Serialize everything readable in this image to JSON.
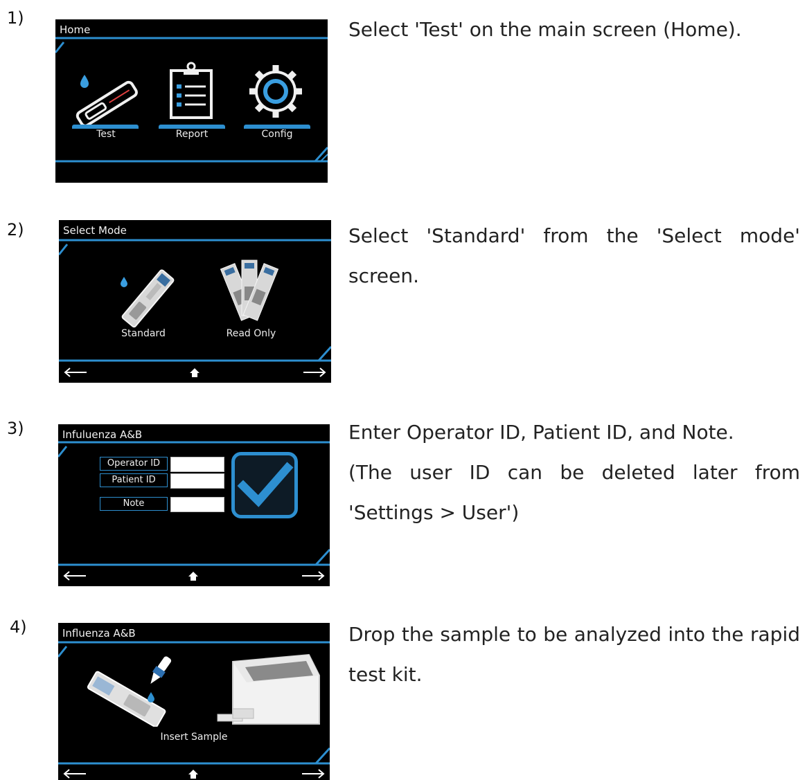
{
  "steps": [
    {
      "number": "1)",
      "description": "Select 'Test' on the main screen (Home).",
      "screen": {
        "title": "Home",
        "items": [
          {
            "label": "Test",
            "icon": "test-strip-icon"
          },
          {
            "label": "Report",
            "icon": "clipboard-report-icon"
          },
          {
            "label": "Config",
            "icon": "gear-icon"
          }
        ]
      }
    },
    {
      "number": "2)",
      "description": "Select 'Standard' from the 'Select mode' screen.",
      "screen": {
        "title": "Select Mode",
        "items": [
          {
            "label": "Standard",
            "icon": "single-test-strip-icon"
          },
          {
            "label": "Read Only",
            "icon": "multiple-test-strips-icon"
          }
        ]
      }
    },
    {
      "number": "3)",
      "description": "Enter Operator ID, Patient ID, and Note.",
      "description_2": "(The user ID can be deleted later from 'Settings > User')",
      "screen": {
        "title": "Infuluenza A&B",
        "fields": [
          {
            "label": "Operator ID",
            "value": ""
          },
          {
            "label": "Patient ID",
            "value": ""
          },
          {
            "label": "Note",
            "value": ""
          }
        ],
        "confirm_icon": "checkmark-icon"
      }
    },
    {
      "number": "4)",
      "description": "Drop the sample to be analyzed into the rapid test kit.",
      "screen": {
        "title": "Influenza A&B",
        "caption": "Insert Sample"
      }
    }
  ],
  "nav": {
    "back_icon": "back-arrow-icon",
    "home_icon": "home-icon",
    "next_icon": "next-arrow-icon"
  },
  "colors": {
    "accent": "#2d8fd0",
    "screen_bg": "#000000",
    "text": "#222222"
  }
}
